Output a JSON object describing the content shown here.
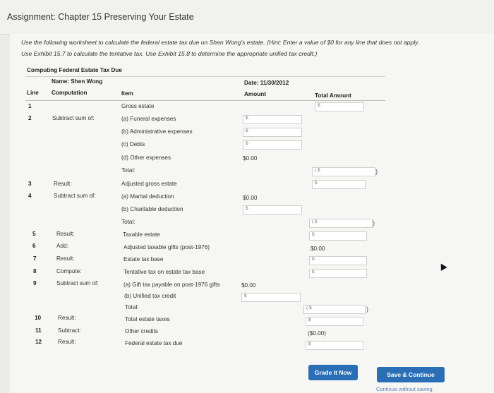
{
  "header": {
    "title": "Assignment: Chapter 15 Preserving Your Estate"
  },
  "instructions": {
    "line1": "Use the following worksheet to calculate the federal estate tax due on Shen Wong's estate. (Hint: Enter a value of $0 for any line that does not apply.",
    "line2": "Use Exhibit 15.7 to calculate the tentative tax. Use Exhibit 15.8 to determine the appropriate unified tax credit.)"
  },
  "worksheet": {
    "title": "Computing Federal Estate Tax Due",
    "name": "Name: Shen Wong",
    "date": "Date: 11/30/2012",
    "col_line": "Line",
    "col_computation": "Computation",
    "col_item": "Item",
    "col_amount": "Amount",
    "col_total": "Total Amount",
    "rows": [
      {
        "line": "1",
        "comp": "",
        "item": "Gross estate",
        "amount": "",
        "total": "$"
      },
      {
        "line": "2",
        "comp": "Subtract sum of:",
        "item": "(a) Funeral expenses",
        "amount": "$",
        "total": ""
      },
      {
        "line": "",
        "comp": "",
        "item": "(b) Administrative expenses",
        "amount": "$",
        "total": ""
      },
      {
        "line": "",
        "comp": "",
        "item": "(c) Debts",
        "amount": "$",
        "total": ""
      },
      {
        "line": "",
        "comp": "",
        "item": "(d) Other expenses",
        "amount": "$0.00",
        "total": ""
      },
      {
        "line": "",
        "comp": "",
        "item": "Total:",
        "amount": "",
        "total": "( $"
      },
      {
        "line": "3",
        "comp": "Result:",
        "item": "Adjusted gross estate",
        "amount": "",
        "total": "$"
      },
      {
        "line": "4",
        "comp": "Subtract sum of:",
        "item": "(a) Marital deduction",
        "amount": "$0.00",
        "total": ""
      },
      {
        "line": "",
        "comp": "",
        "item": "(b) Charitable deduction",
        "amount": "$",
        "total": ""
      },
      {
        "line": "",
        "comp": "",
        "item": "Total:",
        "amount": "",
        "total": "( $"
      },
      {
        "line": "5",
        "comp": "Result:",
        "item": "Taxable estate",
        "amount": "",
        "total": "$"
      },
      {
        "line": "6",
        "comp": "Add:",
        "item": "Adjusted taxable gifts (post-1976)",
        "amount": "",
        "total": "$0.00"
      },
      {
        "line": "7",
        "comp": "Result:",
        "item": "Estate tax base",
        "amount": "",
        "total": "$"
      },
      {
        "line": "8",
        "comp": "Compute:",
        "item": "Tentative tax on estate tax base",
        "amount": "",
        "total": "$"
      },
      {
        "line": "9",
        "comp": "Subtract sum of:",
        "item": "(a) Gift tax payable on post-1976 gifts",
        "amount": "$0.00",
        "total": ""
      },
      {
        "line": "",
        "comp": "",
        "item": "(b) Unified tax credit",
        "amount": "$",
        "total": ""
      },
      {
        "line": "",
        "comp": "",
        "item": "Total:",
        "amount": "",
        "total": "( $"
      },
      {
        "line": "10",
        "comp": "Result:",
        "item": "Total estate taxes",
        "amount": "",
        "total": "$"
      },
      {
        "line": "11",
        "comp": "Subtract:",
        "item": "Other credits",
        "amount": "",
        "total": "($0.00)"
      },
      {
        "line": "12",
        "comp": "Result:",
        "item": "Federal estate tax due",
        "amount": "",
        "total": "$"
      }
    ]
  },
  "buttons": {
    "grade": "Grade It Now",
    "save": "Save & Continue",
    "continue": "Continue without saving"
  }
}
